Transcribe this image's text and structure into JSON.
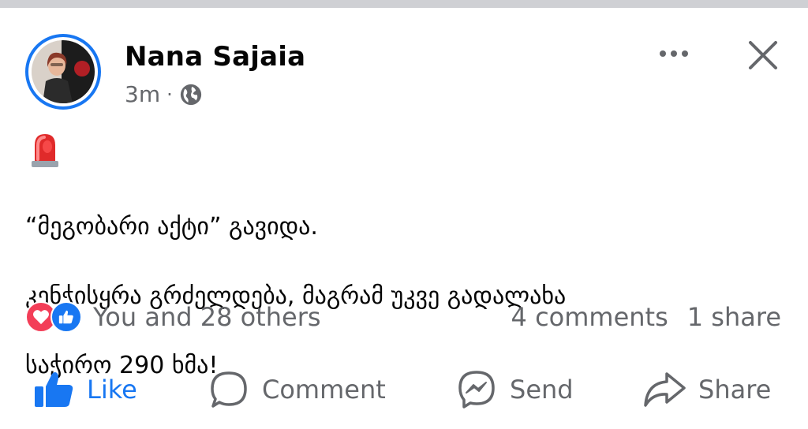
{
  "post": {
    "author": "Nana Sajaia",
    "time": "3m",
    "separator": "·",
    "emoji": "🚨",
    "lines": [
      "“მეგობარი აქტი” გავიდა.",
      "კენჭისყრა გრძელდება, მაგრამ უკვე გადალახა",
      "საჭირო 290 ხმა!"
    ]
  },
  "reactions": {
    "summary": "You and 28 others",
    "types": [
      "love-icon",
      "like-icon"
    ]
  },
  "stats": {
    "comments": "4 comments",
    "shares": "1 share"
  },
  "actions": {
    "like": "Like",
    "comment": "Comment",
    "send": "Send",
    "share": "Share"
  },
  "colors": {
    "accent": "#1877f2",
    "text": "#050505",
    "secondary": "#65676b",
    "love": "#f33e58"
  }
}
